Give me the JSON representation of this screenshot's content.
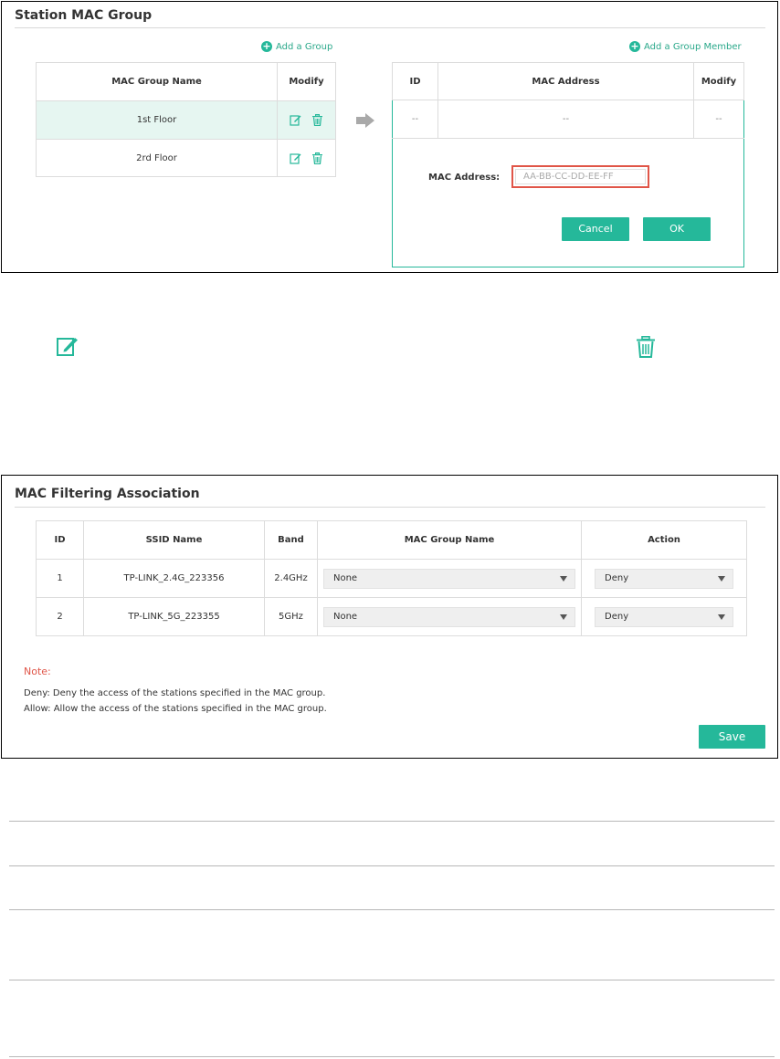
{
  "station": {
    "title": "Station MAC Group",
    "add_group": "Add a Group",
    "add_member": "Add a Group Member",
    "groups_table": {
      "headers": [
        "MAC Group Name",
        "Modify"
      ],
      "rows": [
        "1st Floor",
        "2rd Floor"
      ]
    },
    "members_table": {
      "headers": [
        "ID",
        "MAC Address",
        "Modify"
      ],
      "row": [
        "--",
        "--",
        "--"
      ],
      "field_label": "MAC Address:",
      "field_placeholder": "AA-BB-CC-DD-EE-FF",
      "cancel": "Cancel",
      "ok": "OK"
    }
  },
  "filtering": {
    "title": "MAC Filtering Association",
    "headers": [
      "ID",
      "SSID Name",
      "Band",
      "MAC Group Name",
      "Action"
    ],
    "rows": [
      {
        "id": "1",
        "ssid": "TP-LINK_2.4G_223356",
        "band": "2.4GHz",
        "group": "None",
        "action": "Deny"
      },
      {
        "id": "2",
        "ssid": "TP-LINK_5G_223355",
        "band": "5GHz",
        "group": "None",
        "action": "Deny"
      }
    ],
    "note_label": "Note:",
    "note_deny": "Deny: Deny the access of the stations specified in the MAC group.",
    "note_allow": "Allow: Allow the access of the stations specified in the MAC group.",
    "save": "Save"
  },
  "colors": {
    "accent": "#25b89a",
    "highlight": "#e05548",
    "note": "#e05548",
    "selected_row": "#e6f6f1"
  }
}
